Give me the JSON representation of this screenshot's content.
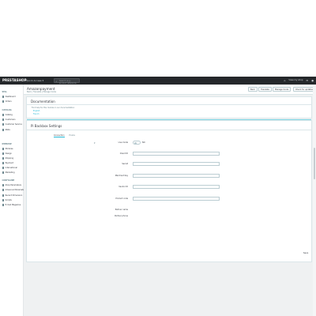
{
  "topbar": {
    "logo": "PRESTASHOP",
    "quick_access": "Quick Access ▾",
    "search_placeholder": "Search (e.g.: product reference, custom...)",
    "links": [
      "View my shop",
      "Notifications",
      "Profile"
    ]
  },
  "sidebar": {
    "sections": [
      {
        "title": "SELL",
        "items": [
          "Dashboard",
          "Orders",
          "Catalog",
          "Customers",
          "Customer Service",
          "Stats"
        ]
      },
      {
        "title": "IMPROVE",
        "items": [
          "Modules",
          "Design",
          "Shipping",
          "Payment",
          "International",
          "Marketing"
        ]
      },
      {
        "title": "CONFIGURE",
        "items": [
          "Shop Parameters",
          "Advanced Parameters",
          "Recent Dimension",
          "Scripts",
          "E-mail Magazine"
        ]
      }
    ]
  },
  "header": {
    "page_title": "Amazonpayment",
    "breadcrumb": "Back | Translate | Manage hooks",
    "buttons": [
      "Back",
      "Translate",
      "Manage hooks",
      "Check for updates"
    ]
  },
  "documentation": {
    "title": "Documentation",
    "text": "Find help for this module in our documentation:",
    "links": [
      "English",
      "French"
    ]
  },
  "settings": {
    "title": "Pi Backbox Settings",
    "tabs": [
      "Connection",
      "Hooks"
    ],
    "fields": [
      {
        "label": "Live mode",
        "type": "switch",
        "value": "NO"
      },
      {
        "label": "Client ID",
        "type": "input",
        "value": "",
        "help": ""
      },
      {
        "label": "Secret",
        "type": "input",
        "value": "",
        "help": ""
      },
      {
        "label": "Merchant Key",
        "type": "input",
        "value": "",
        "help": ""
      },
      {
        "label": "Vendor ID",
        "type": "input",
        "value": "",
        "help": ""
      },
      {
        "label": "Product code",
        "type": "input",
        "value": "",
        "help": ""
      },
      {
        "label": "Partner name",
        "type": "text",
        "value": ""
      },
      {
        "label": "Partner phone",
        "type": "text",
        "value": ""
      }
    ],
    "save_label": "Save"
  },
  "colors": {
    "topbar": "#25282b",
    "accent": "#25b9d7",
    "background": "#eff1f2"
  }
}
